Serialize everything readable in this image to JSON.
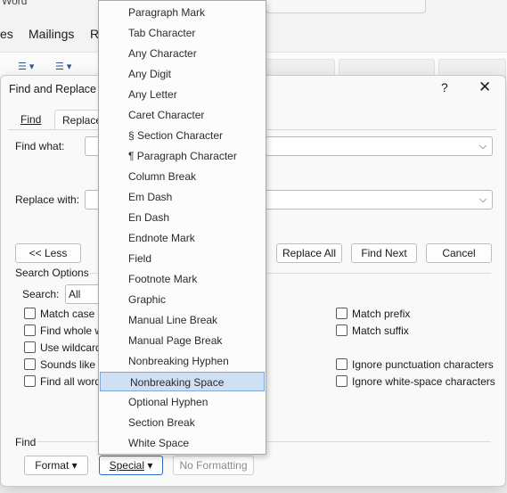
{
  "word": {
    "title": "Word",
    "tabs": [
      "es",
      "Mailings",
      "R"
    ]
  },
  "dialog": {
    "title": "Find and Replace",
    "help": "?",
    "close": "✕",
    "tabs": [
      "Find",
      "Replace"
    ],
    "find_what_label": "Find what:",
    "replace_with_label": "Replace with:",
    "less_button": "<< Less",
    "replace_all": "Replace All",
    "find_next": "Find Next",
    "cancel": "Cancel",
    "search_options_label": "Search Options",
    "search_label": "Search:",
    "search_value": "All",
    "left_options": [
      "Match case",
      "Find whole w",
      "Use wildcard",
      "Sounds like (",
      "Find all word"
    ],
    "right_options": [
      "Match prefix",
      "Match suffix",
      "Ignore punctuation characters",
      "Ignore white-space characters"
    ],
    "find_section_label": "Find",
    "format_button": "Format",
    "special_button": "Special",
    "no_formatting_button": "No Formatting"
  },
  "menu": {
    "items": [
      "Paragraph Mark",
      "Tab Character",
      "Any Character",
      "Any Digit",
      "Any Letter",
      "Caret Character",
      "§ Section Character",
      "¶ Paragraph Character",
      "Column Break",
      "Em Dash",
      "En Dash",
      "Endnote Mark",
      "Field",
      "Footnote Mark",
      "Graphic",
      "Manual Line Break",
      "Manual Page Break",
      "Nonbreaking Hyphen",
      "Nonbreaking Space",
      "Optional Hyphen",
      "Section Break",
      "White Space"
    ],
    "selected": "Nonbreaking Space"
  }
}
